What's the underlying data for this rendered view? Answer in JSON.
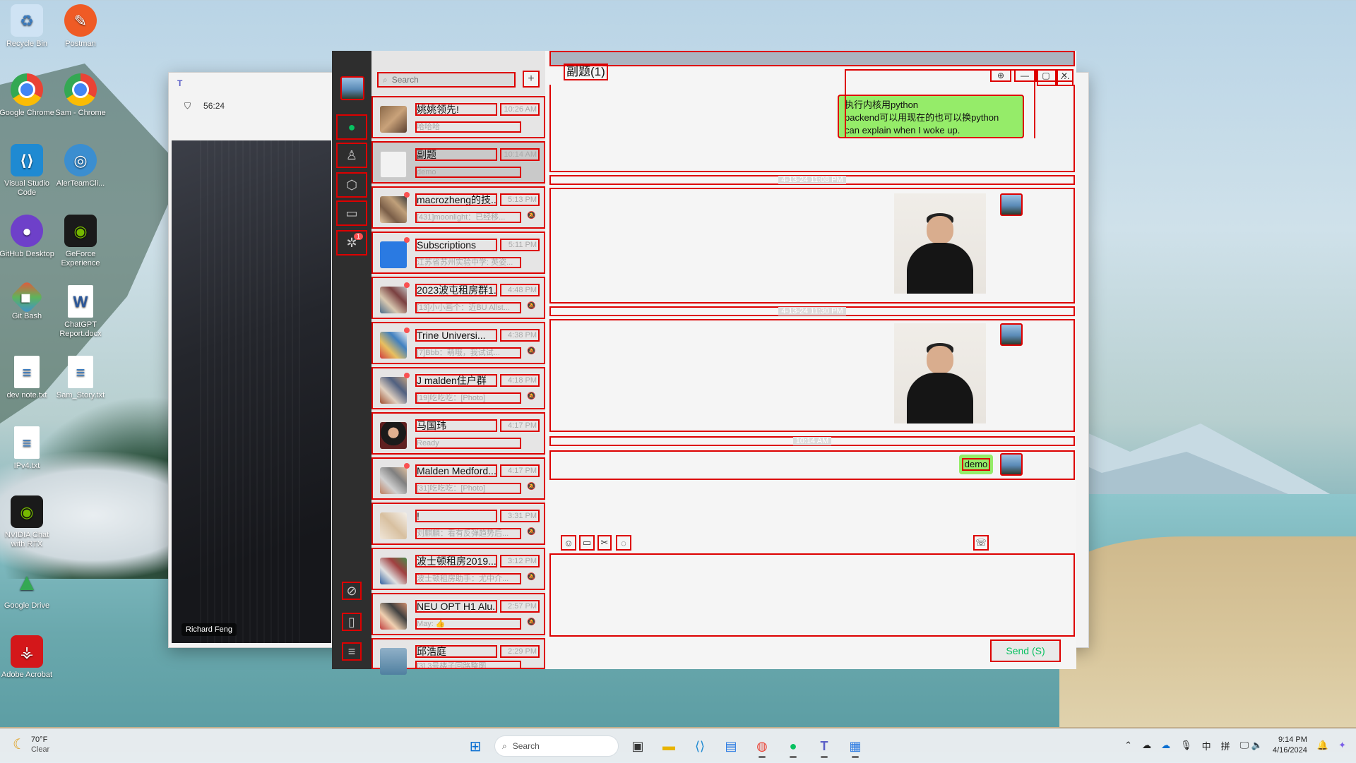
{
  "desktop": {
    "icons": [
      {
        "label": "Recycle Bin"
      },
      {
        "label": "Postman"
      },
      {
        "label": "Google Chrome"
      },
      {
        "label": "Sam - Chrome"
      },
      {
        "label": "Visual Studio Code"
      },
      {
        "label": "AlerTeamCli..."
      },
      {
        "label": "GitHub Desktop"
      },
      {
        "label": "GeForce Experience"
      },
      {
        "label": "Git Bash"
      },
      {
        "label": "ChatGPT Report.docx"
      },
      {
        "label": "dev note.txt"
      },
      {
        "label": "Sam_Story.txt"
      },
      {
        "label": "IPv4.txt"
      },
      {
        "label": "NVIDIA Chat with RTX"
      },
      {
        "label": "Google Drive"
      },
      {
        "label": "Adobe Acrobat"
      }
    ]
  },
  "teams": {
    "timer": "56:24",
    "participant": "Richard Feng"
  },
  "wechat": {
    "search": {
      "placeholder": "Search"
    },
    "chats": [
      {
        "title": "姚姚领先!",
        "time": "10:26 AM",
        "preview": "哈哈哈",
        "unread": false,
        "muted": false
      },
      {
        "title": "副题",
        "time": "10:14 AM",
        "preview": "demo",
        "unread": false,
        "muted": false,
        "selected": true
      },
      {
        "title": "macrozheng的技...",
        "time": "5:13 PM",
        "preview": "[431]moonlight：已经移...",
        "unread": true,
        "muted": true
      },
      {
        "title": "Subscriptions",
        "time": "5:11 PM",
        "preview": "江苏省苏州实验中学: 英姿...",
        "unread": true,
        "muted": false
      },
      {
        "title": "2023波屯租房群1...",
        "time": "4:48 PM",
        "preview": "[13]小小画个：近BU Allst...",
        "unread": true,
        "muted": true
      },
      {
        "title": "Trine Universi...",
        "time": "4:38 PM",
        "preview": "[7]Bbb：萌哦，我试试...",
        "unread": true,
        "muted": true
      },
      {
        "title": "J malden住户群",
        "time": "4:18 PM",
        "preview": "[19]吃吃吃：[Photo]",
        "unread": true,
        "muted": true
      },
      {
        "title": "马国玮",
        "time": "4:17 PM",
        "preview": "Ready",
        "unread": false,
        "muted": false
      },
      {
        "title": "Malden Medford...",
        "time": "4:17 PM",
        "preview": "[31]吃吃吃：[Photo]",
        "unread": true,
        "muted": true
      },
      {
        "title": "!",
        "time": "3:31 PM",
        "preview": "刘麒麟：看有反弹趋势后...",
        "unread": false,
        "muted": true
      },
      {
        "title": "波士顿租房2019...",
        "time": "3:12 PM",
        "preview": "波士顿租房助手：尤中介...",
        "unread": false,
        "muted": true
      },
      {
        "title": "NEU OPT H1 Alu...",
        "time": "2:57 PM",
        "preview": "May: 👍",
        "unread": false,
        "muted": true
      },
      {
        "title": "邱浩庭",
        "time": "2:29 PM",
        "preview": "[3] 3号楼子回路整图",
        "unread": false,
        "muted": false
      }
    ],
    "conversation": {
      "title": "副题",
      "member_count": "(1)",
      "messages": [
        {
          "type": "text",
          "lines": [
            "执行内核用python",
            "backend可以用现在的也可以换python",
            " can explain when I woke up."
          ]
        },
        {
          "type": "time",
          "text": "4-13-24 11:08 PM"
        },
        {
          "type": "image"
        },
        {
          "type": "time",
          "text": "4-13-24 11:30 PM"
        },
        {
          "type": "image"
        },
        {
          "type": "time",
          "text": "10:14 AM"
        },
        {
          "type": "text",
          "lines": [
            "demo"
          ]
        }
      ],
      "send_label": "Send (S)"
    }
  },
  "taskbar": {
    "temp": "70°F",
    "condition": "Clear",
    "search_label": "Search",
    "time": "9:14 PM",
    "date": "4/16/2024",
    "ime_lang": "中",
    "ime_mode": "拼"
  }
}
